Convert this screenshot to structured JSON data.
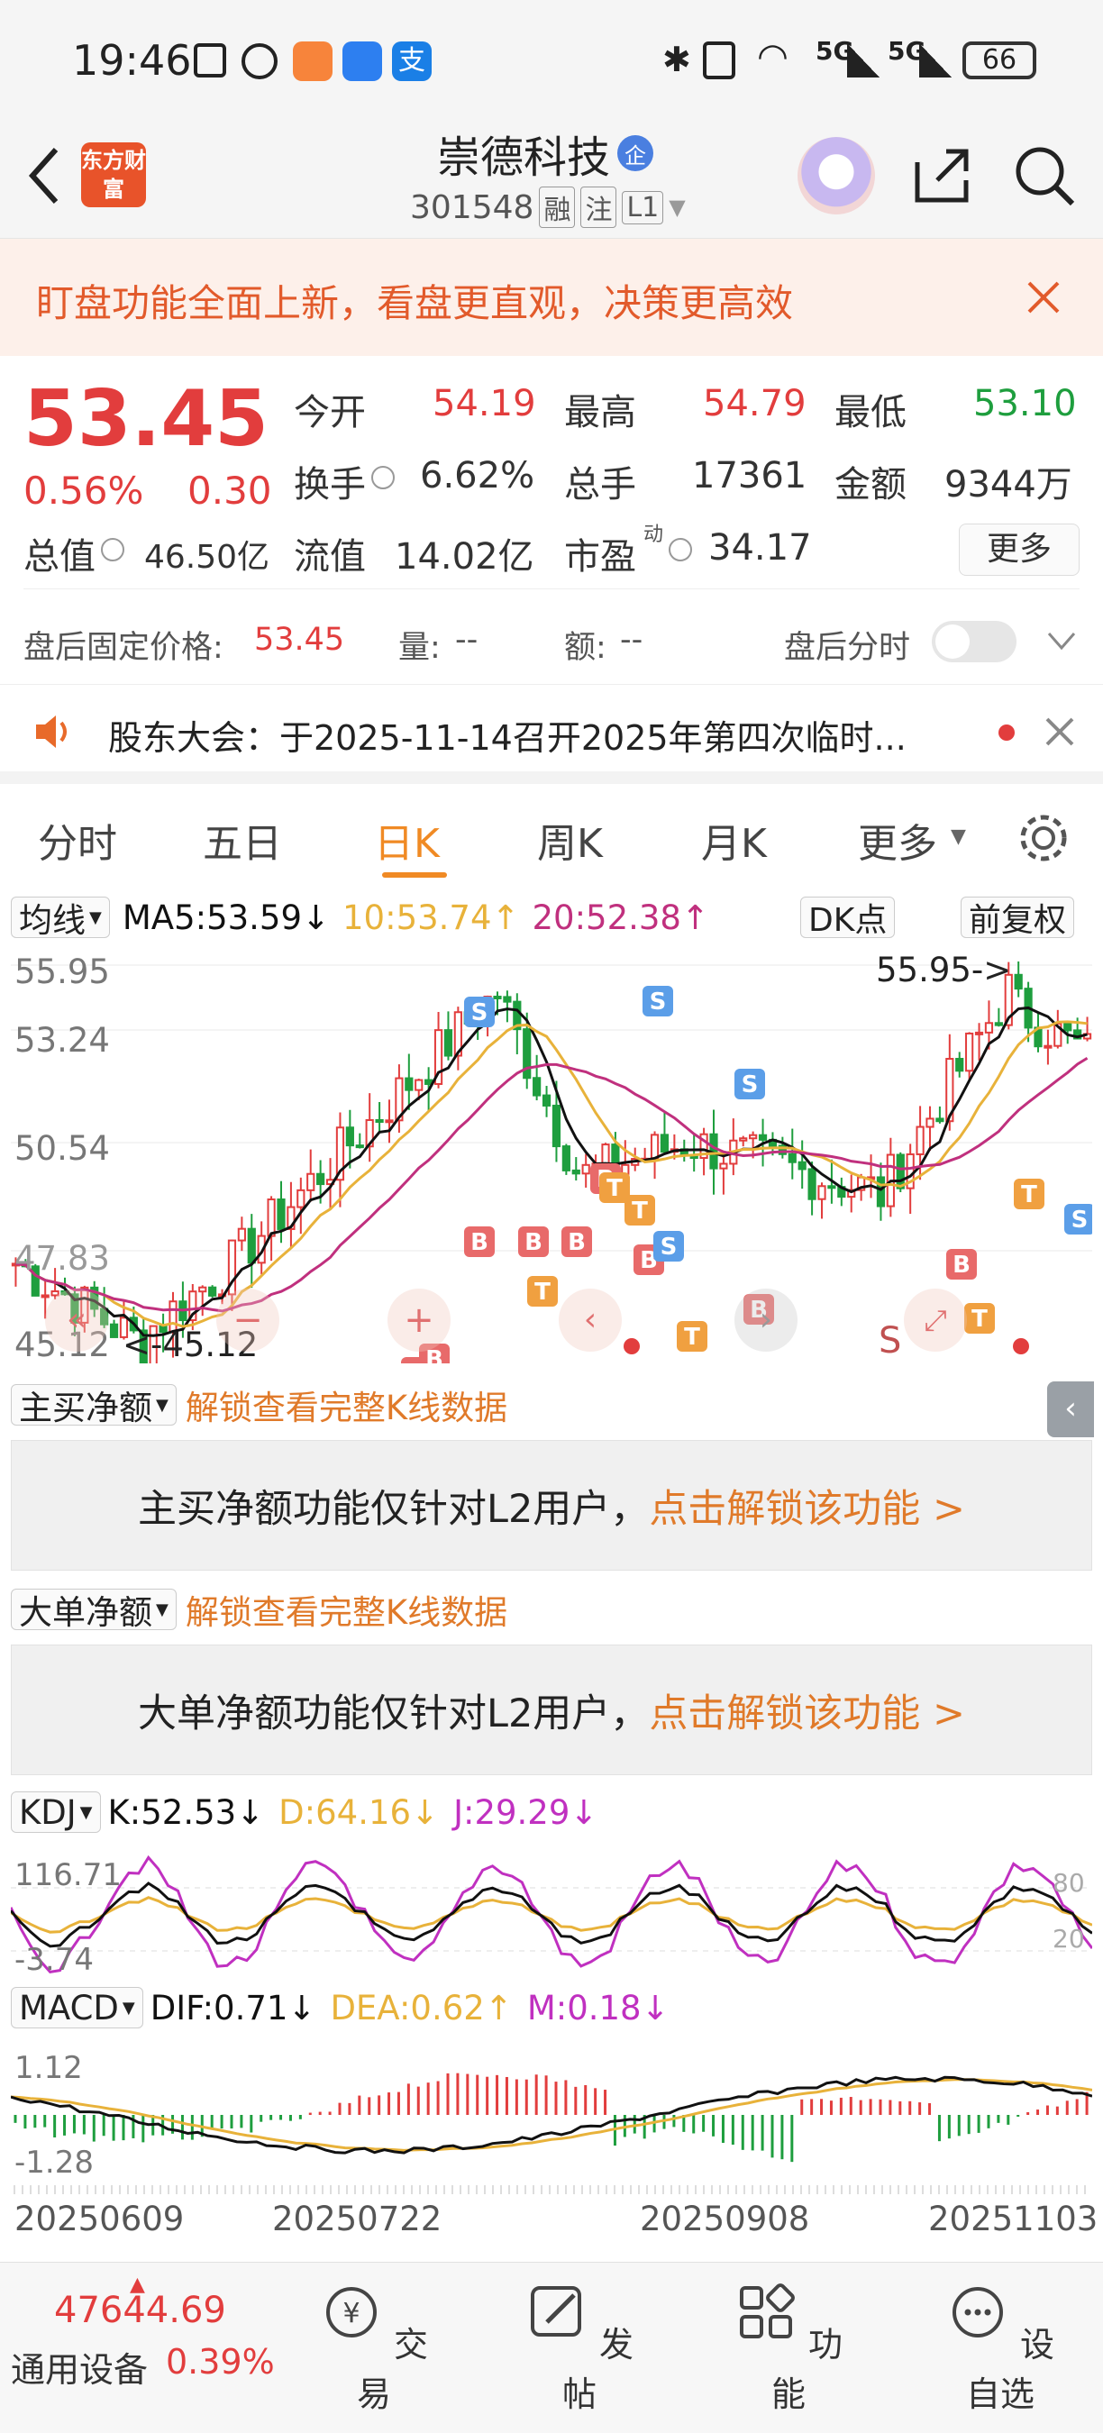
{
  "status_bar": {
    "time": "19:46",
    "network": "5G",
    "battery": "66"
  },
  "header": {
    "title": "崇德科技",
    "logo_text": "东方财富",
    "code": "301548",
    "tags": [
      "融",
      "注",
      "L1"
    ],
    "enterprise_badge": "企"
  },
  "banner": {
    "text": "盯盘功能全面上新，看盘更直观，决策更高效"
  },
  "quote": {
    "price": "53.45",
    "change_pct": "0.56%",
    "change": "0.30",
    "open_label": "今开",
    "open": "54.19",
    "high_label": "最高",
    "high": "54.79",
    "low_label": "最低",
    "low": "53.10",
    "turnover_label": "换手",
    "turnover": "6.62%",
    "volume_label": "总手",
    "volume": "17361",
    "amount_label": "金额",
    "amount": "9344万",
    "mktcap_label": "总值",
    "mktcap": "46.50亿",
    "float_label": "流值",
    "float": "14.02亿",
    "pe_label": "市盈",
    "pe_super": "动",
    "pe": "34.17",
    "more_label": "更多",
    "after_label": "盘后固定价格:",
    "after_price": "53.45",
    "after_vol_label": "量:",
    "after_vol": "--",
    "after_amt_label": "额:",
    "after_amt": "--",
    "after_toggle_label": "盘后分时"
  },
  "notice": {
    "text": "股东大会：于2025-11-14召开2025年第四次临时..."
  },
  "tabs": [
    "分时",
    "五日",
    "日K",
    "周K",
    "月K",
    "更多"
  ],
  "active_tab": "日K",
  "kline": {
    "selector": "均线",
    "ma5": "MA5:53.59↓",
    "ma10": "10:53.74↑",
    "ma20": "20:52.38↑",
    "dk_label": "DK点",
    "adjust_label": "前复权",
    "y_labels": [
      "55.95",
      "53.24",
      "50.54",
      "47.83",
      "45.12"
    ],
    "max_annot": "55.95->",
    "min_annot": "<-45.12",
    "s_label": "S"
  },
  "main_buy": {
    "selector": "主买净额",
    "unlock_link": "解锁查看完整K线数据",
    "panel_text": "主买净额功能仅针对L2用户，",
    "panel_link": "点击解锁该功能 >"
  },
  "big_order": {
    "selector": "大单净额",
    "unlock_link": "解锁查看完整K线数据",
    "panel_text": "大单净额功能仅针对L2用户，",
    "panel_link": "点击解锁该功能 >"
  },
  "kdj": {
    "selector": "KDJ",
    "k": "K:52.53↓",
    "d": "D:64.16↓",
    "j": "J:29.29↓",
    "y_top": "116.71",
    "y_bottom": "-3.74",
    "r80": "80",
    "r20": "20"
  },
  "macd": {
    "selector": "MACD",
    "dif": "DIF:0.71↓",
    "dea": "DEA:0.62↑",
    "m": "M:0.18↓",
    "y_top": "1.12",
    "y_bottom": "-1.28"
  },
  "dates": [
    "20250609",
    "20250722",
    "20250908",
    "20251103"
  ],
  "bottom": {
    "index_value": "47644.69",
    "index_name": "通用设备",
    "index_pct": "0.39%",
    "trade": "交易",
    "post": "发帖",
    "function": "功能",
    "watch": "设自选"
  },
  "colors": {
    "up": "#e23d3d",
    "down": "#1e9e3e",
    "ma5": "#111111",
    "ma10": "#e8b23a",
    "ma20": "#c0307e",
    "accent": "#f08a24"
  }
}
